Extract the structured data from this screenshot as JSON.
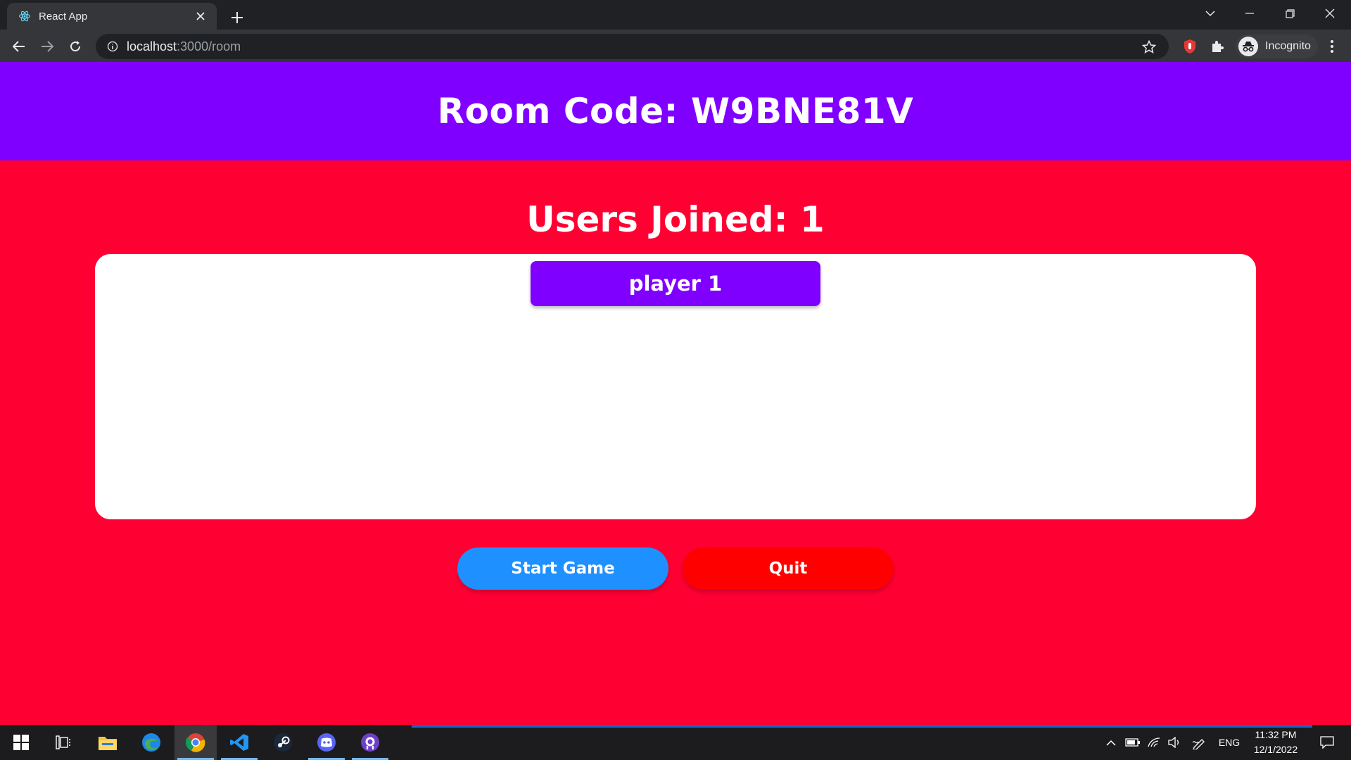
{
  "browser": {
    "tab_title": "React App",
    "url_host": "localhost",
    "url_path": ":3000/room",
    "profile_label": "Incognito",
    "icons": [
      "react-favicon",
      "close-icon",
      "plus-icon",
      "chevron-down-icon",
      "minimize-icon",
      "restore-icon",
      "close-window-icon",
      "back-arrow-icon",
      "forward-arrow-icon",
      "reload-icon",
      "info-icon",
      "star-icon",
      "extension-icon",
      "puzzle-icon",
      "incognito-icon",
      "kebab-menu-icon"
    ]
  },
  "page": {
    "room_code_label": "Room Code: W9BNE81V",
    "users_joined_label": "Users Joined: 1",
    "players": [
      "player 1"
    ],
    "start_button_label": "Start Game",
    "quit_button_label": "Quit",
    "colors": {
      "header_bg": "#8000ff",
      "page_bg": "#ff0033",
      "start_button": "#1e90ff",
      "quit_button": "#ff0000"
    }
  },
  "taskbar": {
    "apps": [
      "windows-start-icon",
      "task-view-icon",
      "file-explorer-icon",
      "edge-icon",
      "chrome-icon",
      "vscode-icon",
      "steam-icon",
      "discord-icon",
      "github-desktop-icon"
    ],
    "language": "ENG",
    "time": "11:32 PM",
    "date": "12/1/2022"
  }
}
